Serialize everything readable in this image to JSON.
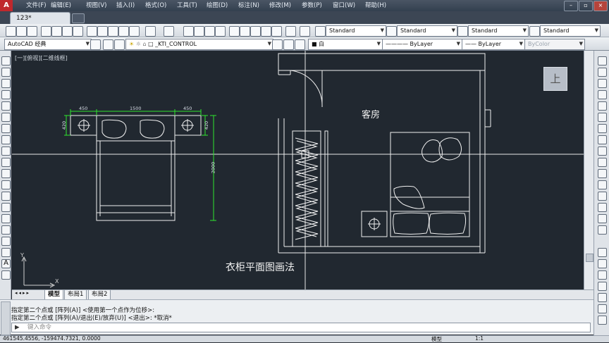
{
  "app": {
    "logo_text": "A"
  },
  "menu": [
    "文件(F)",
    "编辑(E)",
    "视图(V)",
    "插入(I)",
    "格式(O)",
    "工具(T)",
    "绘图(D)",
    "标注(N)",
    "修改(M)",
    "参数(P)",
    "窗口(W)",
    "帮助(H)"
  ],
  "tabs": {
    "active": "123*"
  },
  "toolbar": {
    "text_style": "Standard",
    "dim_style": "Standard",
    "table_style": "Standard",
    "multileader_style": "Standard",
    "workspace": "AutoCAD 经典",
    "layer": "_KTI_CONTROL",
    "color": "白",
    "linetype": "ByLayer",
    "lineweight": "ByLayer",
    "plotstyle": "ByColor"
  },
  "viewport": {
    "label": "[一][俯视][二维线框]",
    "viewcube": "上"
  },
  "drawing": {
    "room_label": "客房",
    "caption": "衣柜平面图画法",
    "dim_450_left": "450",
    "dim_1500": "1500",
    "dim_450_right": "450",
    "dim_420_left": "420",
    "dim_420_right": "420",
    "dim_2000": "2000"
  },
  "layout_tabs": [
    "模型",
    "布局1",
    "布局2"
  ],
  "command": {
    "line1": "指定第二个点或 [阵列(A)] <使用第一个点作为位移>:",
    "line2": "指定第二个点或 [阵列(A)/退出(E)/放弃(U)] <退出>: *取消*",
    "placeholder": "键入命令"
  },
  "status": {
    "coords": "461545.4556, -159474.7321, 0.0000",
    "model": "模型",
    "scale": "1:1"
  }
}
